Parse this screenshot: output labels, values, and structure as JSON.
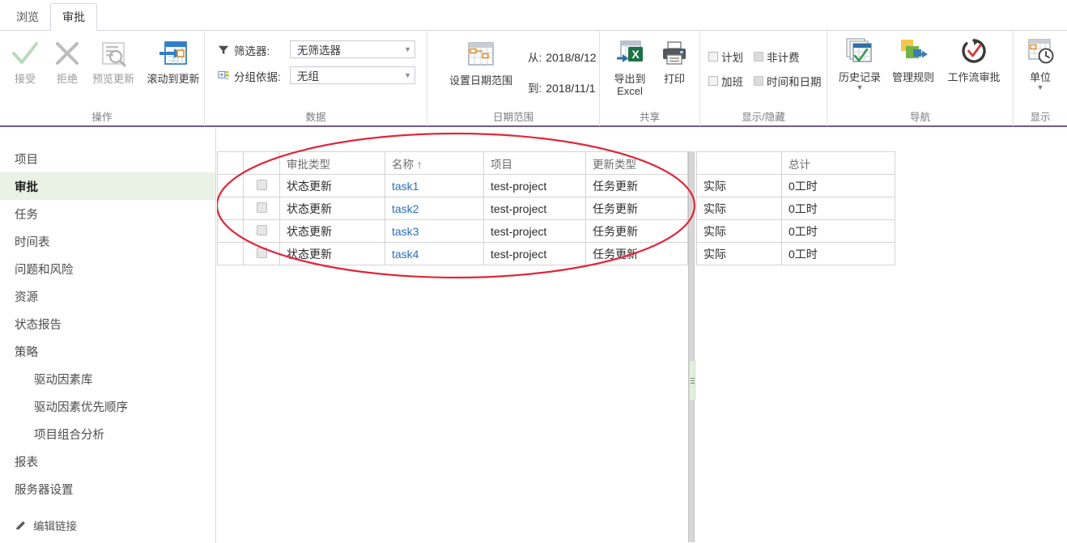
{
  "tabs": [
    {
      "id": "browse",
      "label": "浏览",
      "active": false
    },
    {
      "id": "approve",
      "label": "审批",
      "active": true
    }
  ],
  "ribbon": {
    "groups": [
      {
        "id": "operations",
        "title": "操作",
        "buttons": [
          {
            "id": "accept",
            "label": "接受",
            "icon": "check-icon"
          },
          {
            "id": "reject",
            "label": "拒绝",
            "icon": "cross-icon"
          },
          {
            "id": "preview",
            "label": "预览更新",
            "icon": "preview-updates-icon"
          },
          {
            "id": "scroll",
            "label": "滚动到更新",
            "icon": "scroll-to-update-icon"
          }
        ]
      },
      {
        "id": "data",
        "title": "数据",
        "filter_label": "筛选器:",
        "filter_value": "无筛选器",
        "groupby_label": "分组依据:",
        "groupby_value": "无组"
      },
      {
        "id": "daterange",
        "title": "日期范围",
        "set_range_label": "设置日期范围",
        "from_label": "从:",
        "from_value": "2018/8/12",
        "to_label": "到:",
        "to_value": "2018/11/1"
      },
      {
        "id": "share",
        "title": "共享",
        "buttons": [
          {
            "id": "export-excel",
            "label": "导出到\nExcel",
            "icon": "export-excel-icon"
          },
          {
            "id": "print",
            "label": "打印",
            "icon": "printer-icon"
          }
        ]
      },
      {
        "id": "showhide",
        "title": "显示/隐藏",
        "checkboxes": [
          {
            "id": "planned",
            "label": "计划",
            "checked": false
          },
          {
            "id": "nonbillable",
            "label": "非计费",
            "checked": false,
            "grey": true
          },
          {
            "id": "overtime",
            "label": "加班",
            "checked": false
          },
          {
            "id": "time-and-date",
            "label": "时间和日期",
            "checked": false,
            "grey": true
          }
        ]
      },
      {
        "id": "navigation",
        "title": "导航",
        "buttons": [
          {
            "id": "history",
            "label": "历史记录",
            "icon": "history-icon",
            "dropdown": true
          },
          {
            "id": "manage-rules",
            "label": "管理规则",
            "icon": "manage-rules-icon",
            "dropdown": false
          },
          {
            "id": "workflow-approvals",
            "label": "工作流审批",
            "icon": "workflow-approval-icon",
            "dropdown": false
          }
        ]
      },
      {
        "id": "display",
        "title": "显示",
        "buttons": [
          {
            "id": "units",
            "label": "单位",
            "icon": "units-calendar-clock-icon",
            "dropdown": true
          }
        ]
      }
    ]
  },
  "sidebar": {
    "items": [
      {
        "id": "projects",
        "label": "项目",
        "sub": false,
        "selected": false
      },
      {
        "id": "approvals",
        "label": "审批",
        "sub": false,
        "selected": true
      },
      {
        "id": "tasks",
        "label": "任务",
        "sub": false,
        "selected": false
      },
      {
        "id": "timesheet",
        "label": "时间表",
        "sub": false,
        "selected": false
      },
      {
        "id": "issues-and-risks",
        "label": "问题和风险",
        "sub": false,
        "selected": false
      },
      {
        "id": "resources",
        "label": "资源",
        "sub": false,
        "selected": false
      },
      {
        "id": "status-reports",
        "label": "状态报告",
        "sub": false,
        "selected": false
      },
      {
        "id": "strategy",
        "label": "策略",
        "sub": false,
        "selected": false
      },
      {
        "id": "driver-library",
        "label": "驱动因素库",
        "sub": true,
        "selected": false
      },
      {
        "id": "driver-priority",
        "label": "驱动因素优先顺序",
        "sub": true,
        "selected": false
      },
      {
        "id": "portfolio-analysis",
        "label": "项目组合分析",
        "sub": true,
        "selected": false
      },
      {
        "id": "reports",
        "label": "报表",
        "sub": false,
        "selected": false
      },
      {
        "id": "server-settings",
        "label": "服务器设置",
        "sub": false,
        "selected": false
      }
    ],
    "edit_links_label": "编辑链接"
  },
  "grid": {
    "left": {
      "headers": [
        "",
        "",
        "审批类型",
        "名称 ↑",
        "项目",
        "更新类型"
      ],
      "rows": [
        {
          "checkbox": true,
          "approval_type": "状态更新",
          "name": "task1",
          "project": "test-project",
          "update_type": "任务更新"
        },
        {
          "checkbox": true,
          "approval_type": "状态更新",
          "name": "task2",
          "project": "test-project",
          "update_type": "任务更新"
        },
        {
          "checkbox": true,
          "approval_type": "状态更新",
          "name": "task3",
          "project": "test-project",
          "update_type": "任务更新"
        },
        {
          "checkbox": true,
          "approval_type": "状态更新",
          "name": "task4",
          "project": "test-project",
          "update_type": "任务更新"
        }
      ]
    },
    "right": {
      "headers": [
        "",
        "总计"
      ],
      "rows": [
        {
          "kind": "实际",
          "total": "0工时"
        },
        {
          "kind": "实际",
          "total": "0工时"
        },
        {
          "kind": "实际",
          "total": "0工时"
        },
        {
          "kind": "实际",
          "total": "0工时"
        }
      ]
    }
  },
  "annotation": {
    "shape": "ellipse",
    "color": "#e0263a"
  },
  "colors": {
    "ribbon_accent": "#6e5b8d",
    "selected_nav": "#e9f2e4",
    "link": "#2a6ebb",
    "annotation": "#e0263a"
  }
}
